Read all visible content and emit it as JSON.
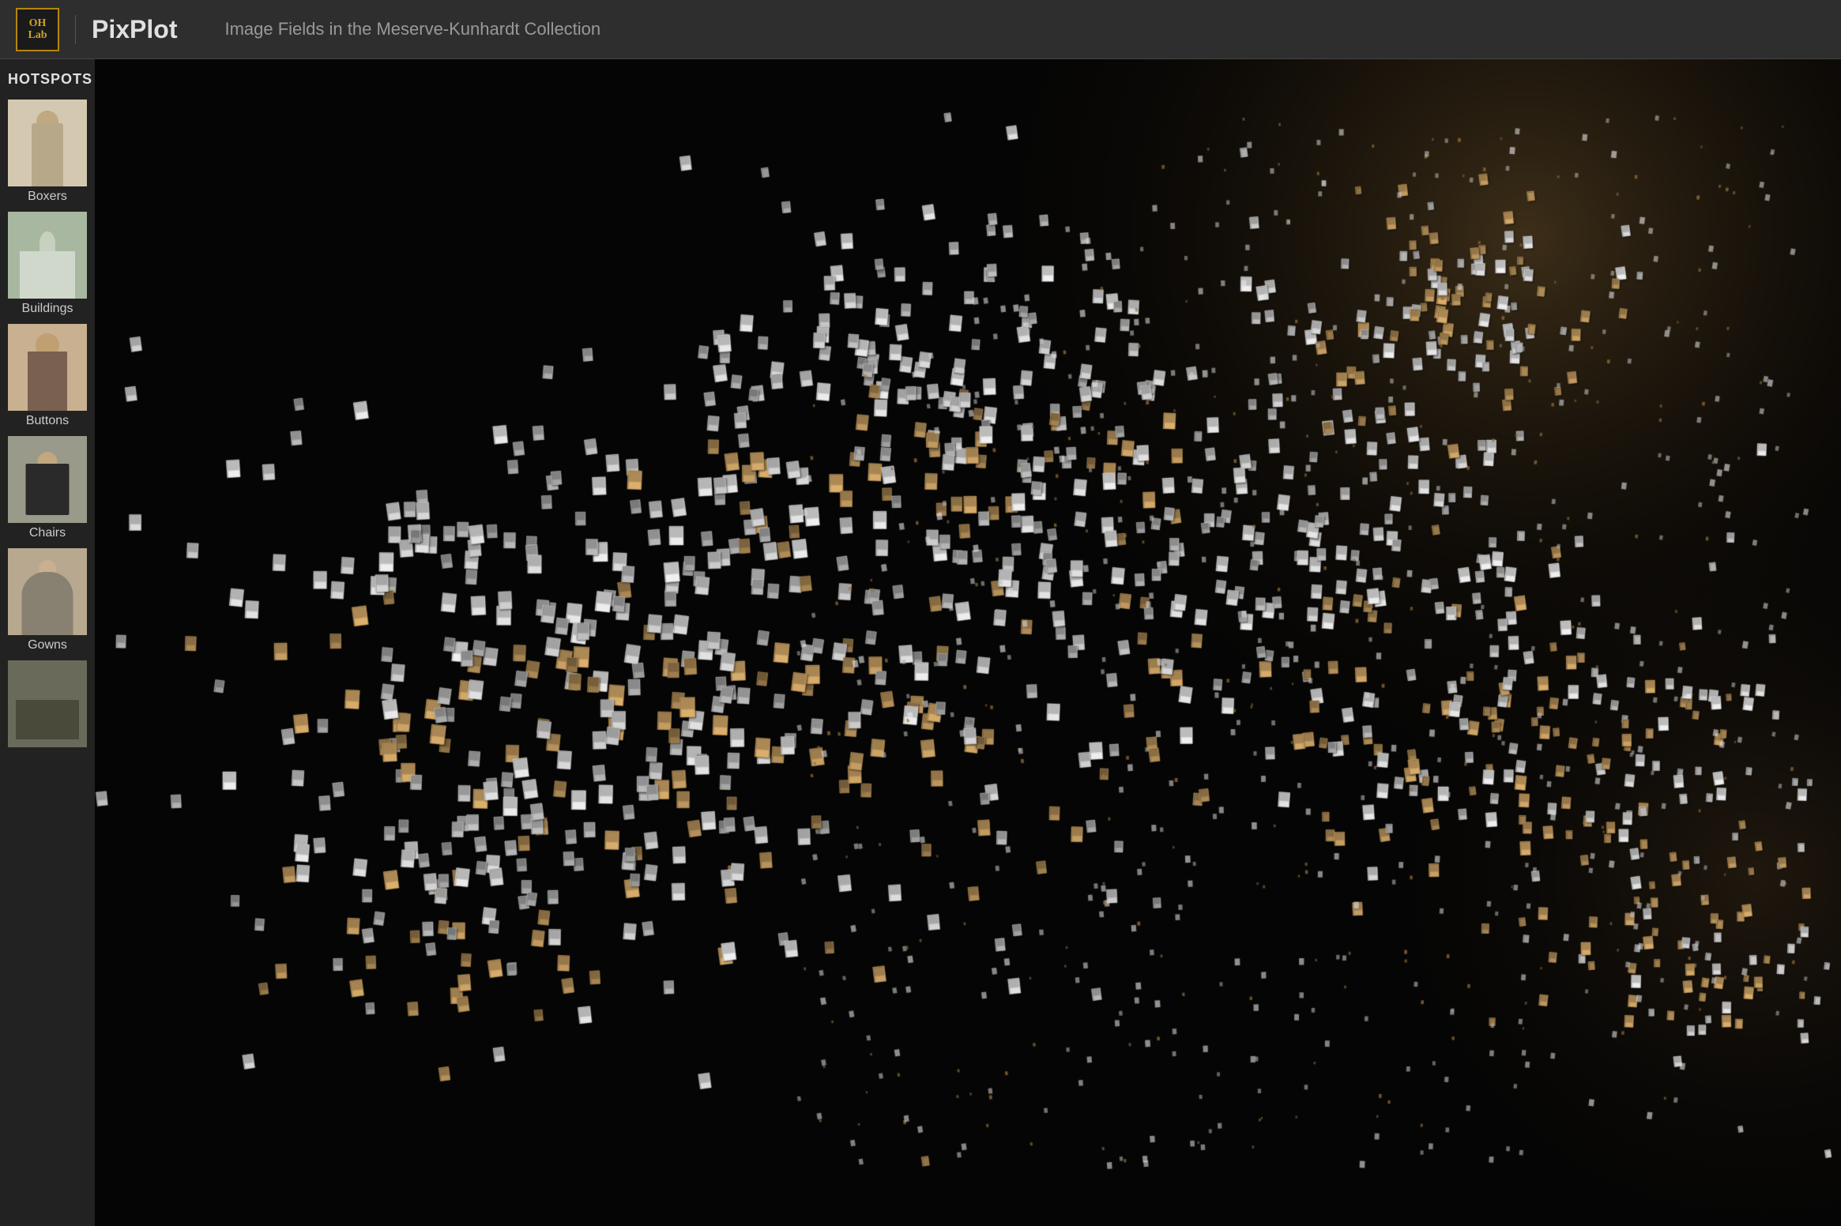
{
  "header": {
    "logo_text": "OH\nLab",
    "app_title": "PixPlot",
    "collection_title": "Image Fields in the Meserve-Kunhardt Collection"
  },
  "sidebar": {
    "section_label": "HOTSPOTS",
    "items": [
      {
        "id": "boxers",
        "label": "Boxers",
        "thumb_class": "thumb-boxers"
      },
      {
        "id": "buildings",
        "label": "Buildings",
        "thumb_class": "thumb-buildings"
      },
      {
        "id": "buttons",
        "label": "Buttons",
        "thumb_class": "thumb-buttons"
      },
      {
        "id": "chairs",
        "label": "Chairs",
        "thumb_class": "thumb-chairs"
      },
      {
        "id": "gowns",
        "label": "Gowns",
        "thumb_class": "thumb-gowns"
      },
      {
        "id": "group",
        "label": "",
        "thumb_class": "thumb-group"
      }
    ]
  },
  "visualization": {
    "background_color": "#050505",
    "dot_color_light": "#d0d0d0",
    "dot_color_warm": "#c8a060"
  }
}
